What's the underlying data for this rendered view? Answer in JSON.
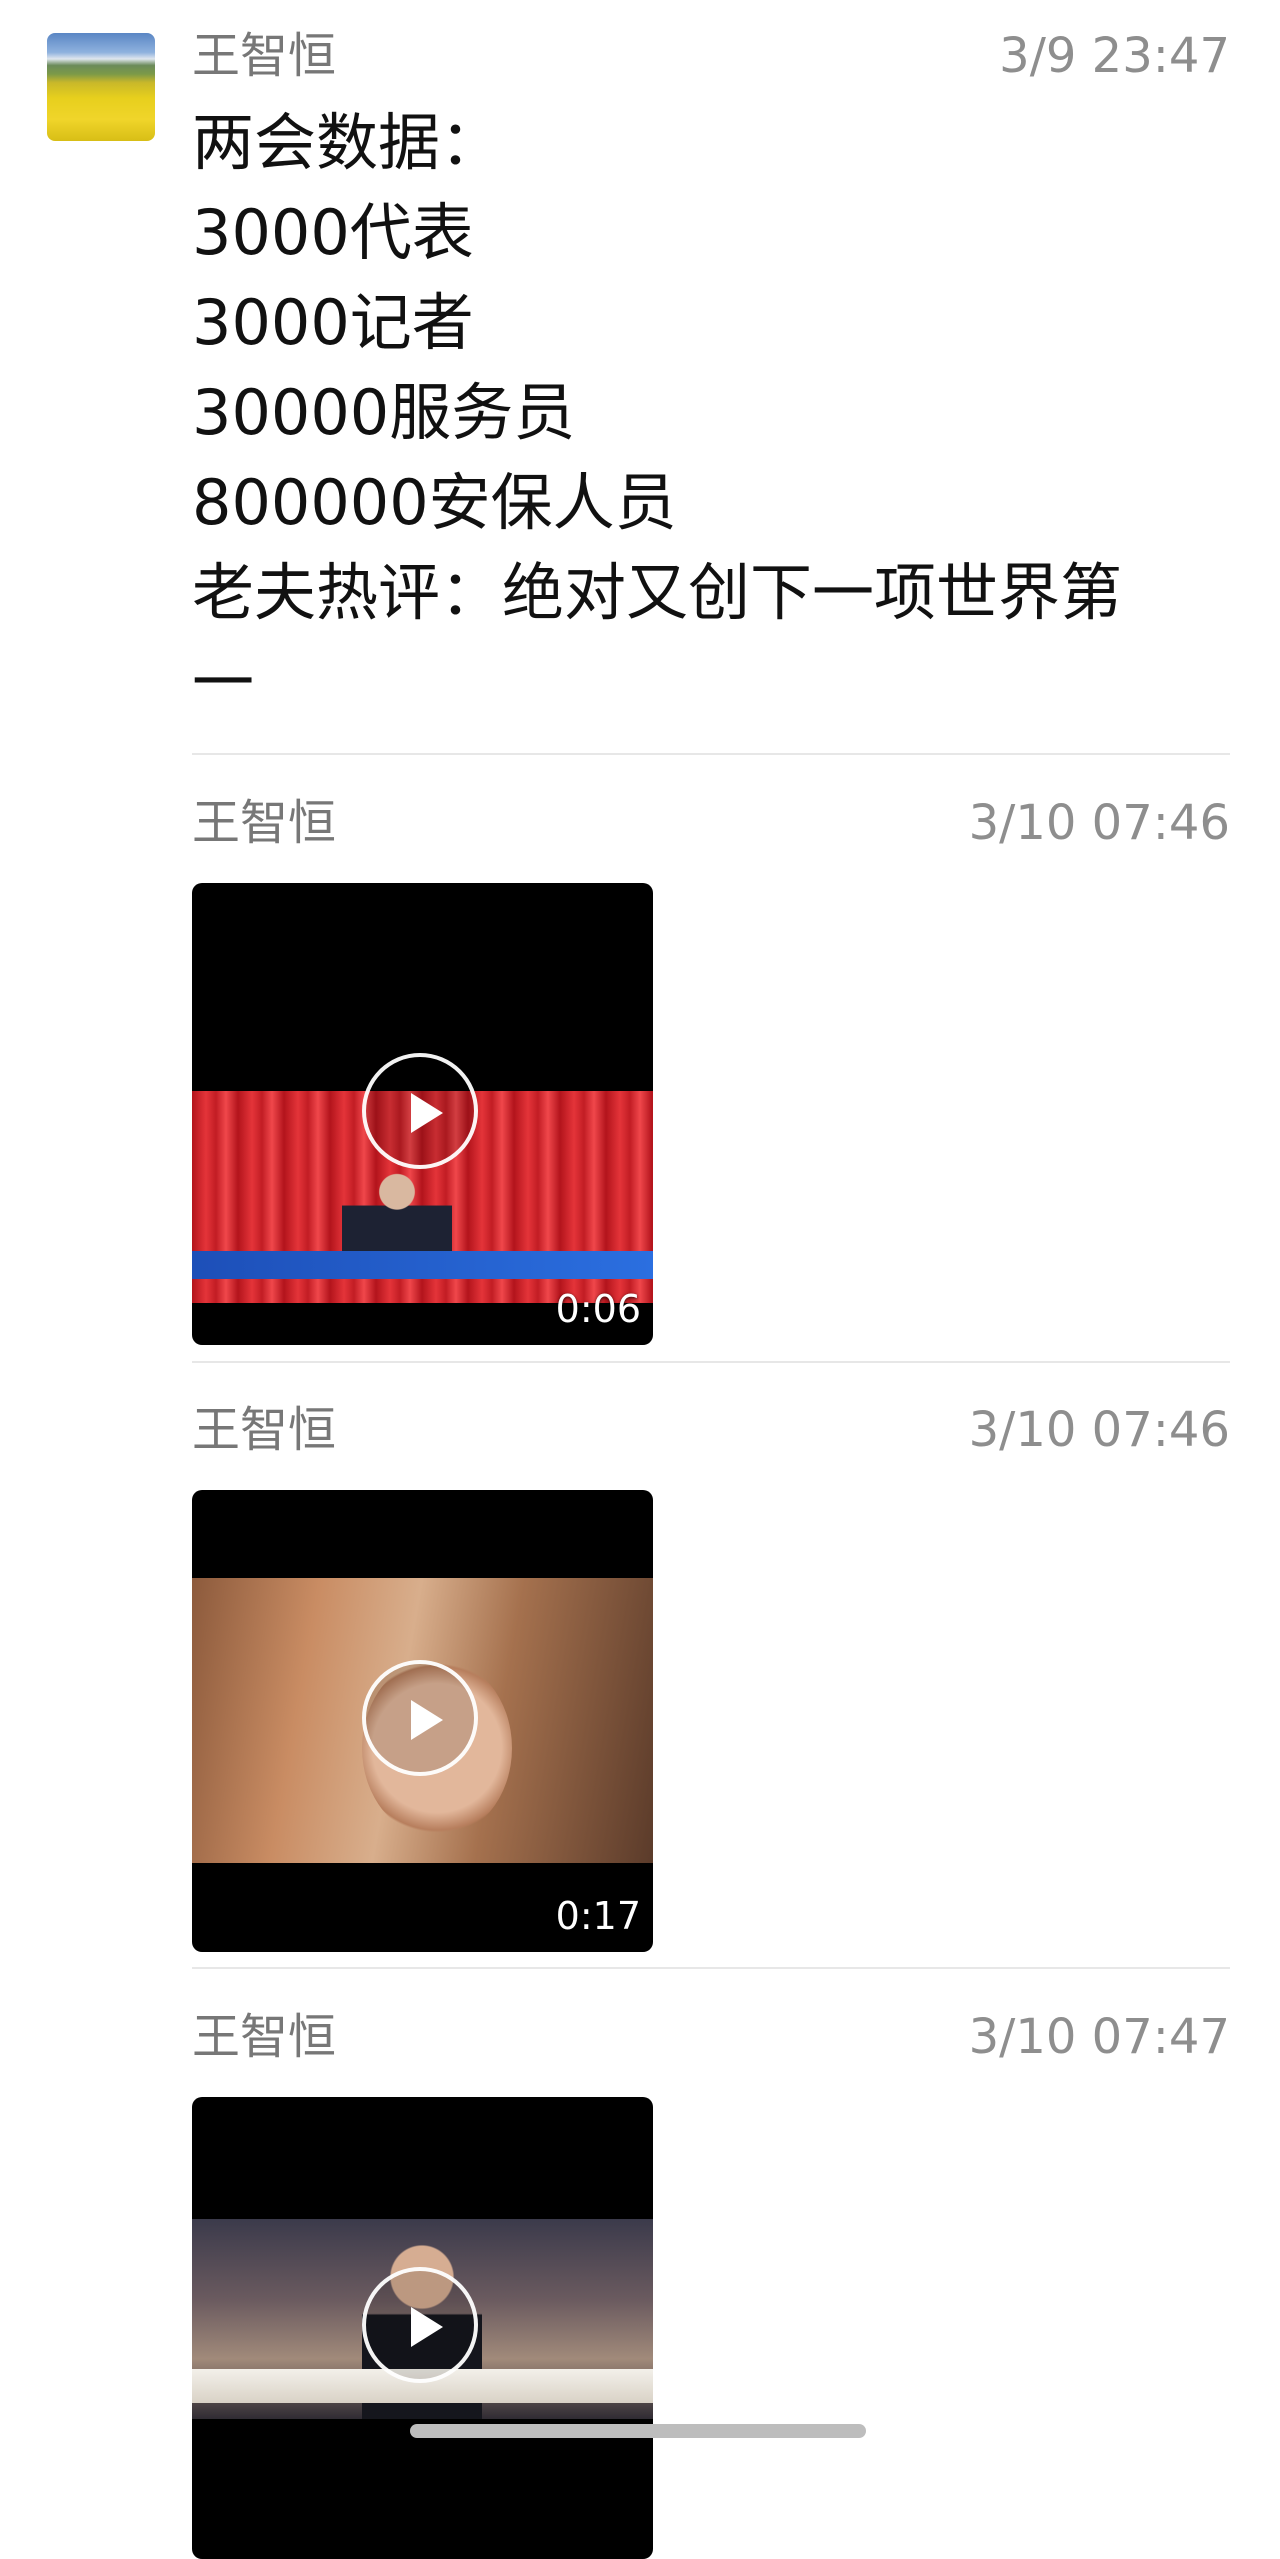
{
  "messages": [
    {
      "sender": "王智恒",
      "time": "3/9 23:47",
      "lines": [
        "两会数据：",
        "3000代表",
        "3000记者",
        "30000服务员",
        "800000安保人员",
        "老夫热评：绝对又创下一项世界第",
        "一"
      ]
    },
    {
      "sender": "王智恒",
      "time": "3/10 07:46",
      "video": {
        "duration": "0:06"
      }
    },
    {
      "sender": "王智恒",
      "time": "3/10 07:46",
      "video": {
        "duration": "0:17"
      }
    },
    {
      "sender": "王智恒",
      "time": "3/10 07:47",
      "video": {
        "duration": ""
      }
    }
  ],
  "icons": {
    "avatar": "landscape-avatar",
    "play": "play-icon"
  },
  "colors": {
    "sender": "#777777",
    "time": "#8e8e8e",
    "text": "#111111",
    "divider": "#e7e7e7",
    "video_bg": "#000000"
  }
}
